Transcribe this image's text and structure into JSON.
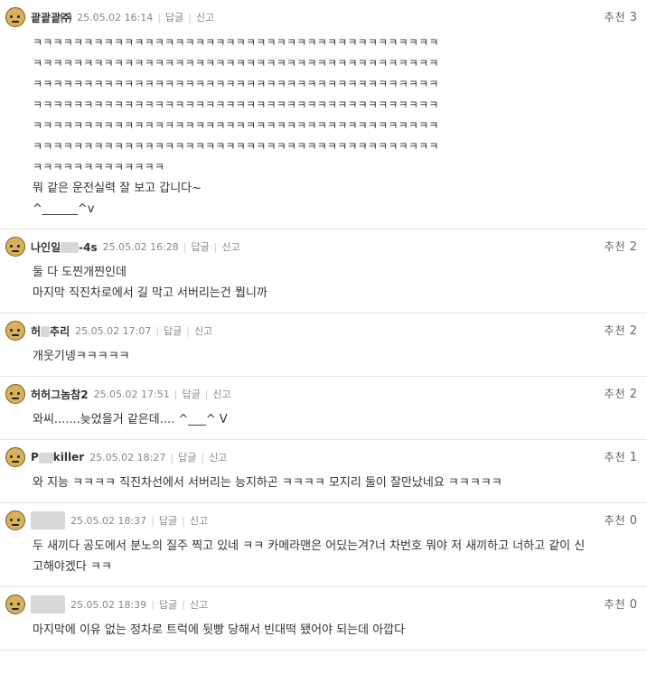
{
  "comments": [
    {
      "nick": "괕괕괕㈜",
      "date": "25.05.02 16:14",
      "reply": "답글",
      "report": "신고",
      "rec_label": "추천",
      "rec_count": "3",
      "lines": [
        "ㅋㅋㅋㅋㅋㅋㅋㅋㅋㅋㅋㅋㅋㅋㅋㅋㅋㅋㅋㅋㅋㅋㅋㅋㅋㅋㅋㅋㅋㅋㅋㅋㅋㅋㅋㅋㅋㅋㅋㅋ",
        "ㅋㅋㅋㅋㅋㅋㅋㅋㅋㅋㅋㅋㅋㅋㅋㅋㅋㅋㅋㅋㅋㅋㅋㅋㅋㅋㅋㅋㅋㅋㅋㅋㅋㅋㅋㅋㅋㅋㅋㅋ",
        "ㅋㅋㅋㅋㅋㅋㅋㅋㅋㅋㅋㅋㅋㅋㅋㅋㅋㅋㅋㅋㅋㅋㅋㅋㅋㅋㅋㅋㅋㅋㅋㅋㅋㅋㅋㅋㅋㅋㅋㅋ",
        "ㅋㅋㅋㅋㅋㅋㅋㅋㅋㅋㅋㅋㅋㅋㅋㅋㅋㅋㅋㅋㅋㅋㅋㅋㅋㅋㅋㅋㅋㅋㅋㅋㅋㅋㅋㅋㅋㅋㅋㅋ",
        "ㅋㅋㅋㅋㅋㅋㅋㅋㅋㅋㅋㅋㅋㅋㅋㅋㅋㅋㅋㅋㅋㅋㅋㅋㅋㅋㅋㅋㅋㅋㅋㅋㅋㅋㅋㅋㅋㅋㅋㅋ",
        "ㅋㅋㅋㅋㅋㅋㅋㅋㅋㅋㅋㅋㅋㅋㅋㅋㅋㅋㅋㅋㅋㅋㅋㅋㅋㅋㅋㅋㅋㅋㅋㅋㅋㅋㅋㅋㅋㅋㅋㅋ",
        "ㅋㅋㅋㅋㅋㅋㅋㅋㅋㅋㅋㅋㅋ",
        "",
        "뭐 같은 운전실력 잘 보고 갑니다~",
        "",
        "^______^v"
      ]
    },
    {
      "nick": "나인일",
      "nick_suffix": "-4s",
      "date": "25.05.02 16:28",
      "reply": "답글",
      "report": "신고",
      "rec_label": "추천",
      "rec_count": "2",
      "lines": [
        "둘 다 도찐개찐인데",
        "마지막 직진차로에서 길 막고 서버리는건 뭡니까"
      ]
    },
    {
      "nick": "허",
      "nick_suffix": "추리",
      "date": "25.05.02 17:07",
      "reply": "답글",
      "report": "신고",
      "rec_label": "추천",
      "rec_count": "2",
      "lines": [
        "개웃기넹ㅋㅋㅋㅋㅋ"
      ]
    },
    {
      "nick": "허허그놈참2",
      "date": "25.05.02 17:51",
      "reply": "답글",
      "report": "신고",
      "rec_label": "추천",
      "rec_count": "2",
      "lines": [
        "와씨.......늦었을거 같은데.... ^___^ V"
      ]
    },
    {
      "nick": "P",
      "nick_suffix": "killer",
      "date": "25.05.02 18:27",
      "reply": "답글",
      "report": "신고",
      "rec_label": "추천",
      "rec_count": "1",
      "lines": [
        "와 지능 ㅋㅋㅋㅋ 직진차선에서 서버리는 능지하곤 ㅋㅋㅋㅋ 모지리 둘이 잘만났네요 ㅋㅋㅋㅋㅋ"
      ]
    },
    {
      "nick": "",
      "date": "25.05.02 18:37",
      "reply": "답글",
      "report": "신고",
      "rec_label": "추천",
      "rec_count": "0",
      "lines": [
        "두 새끼다 공도에서 분노의 질주 찍고 있네 ㅋㅋ 카메라맨은 어딨는겨?너 차번호 뭐야 저 새끼하고 너하고 같이 신",
        "고해야겠다 ㅋㅋ"
      ]
    },
    {
      "nick": "",
      "date": "25.05.02 18:39",
      "reply": "답글",
      "report": "신고",
      "rec_label": "추천",
      "rec_count": "0",
      "lines": [
        "마지막에 이유 없는 정차로 트럭에 뒷빵 당해서 빈대떡 됐어야 되는데 아깝다"
      ]
    }
  ]
}
